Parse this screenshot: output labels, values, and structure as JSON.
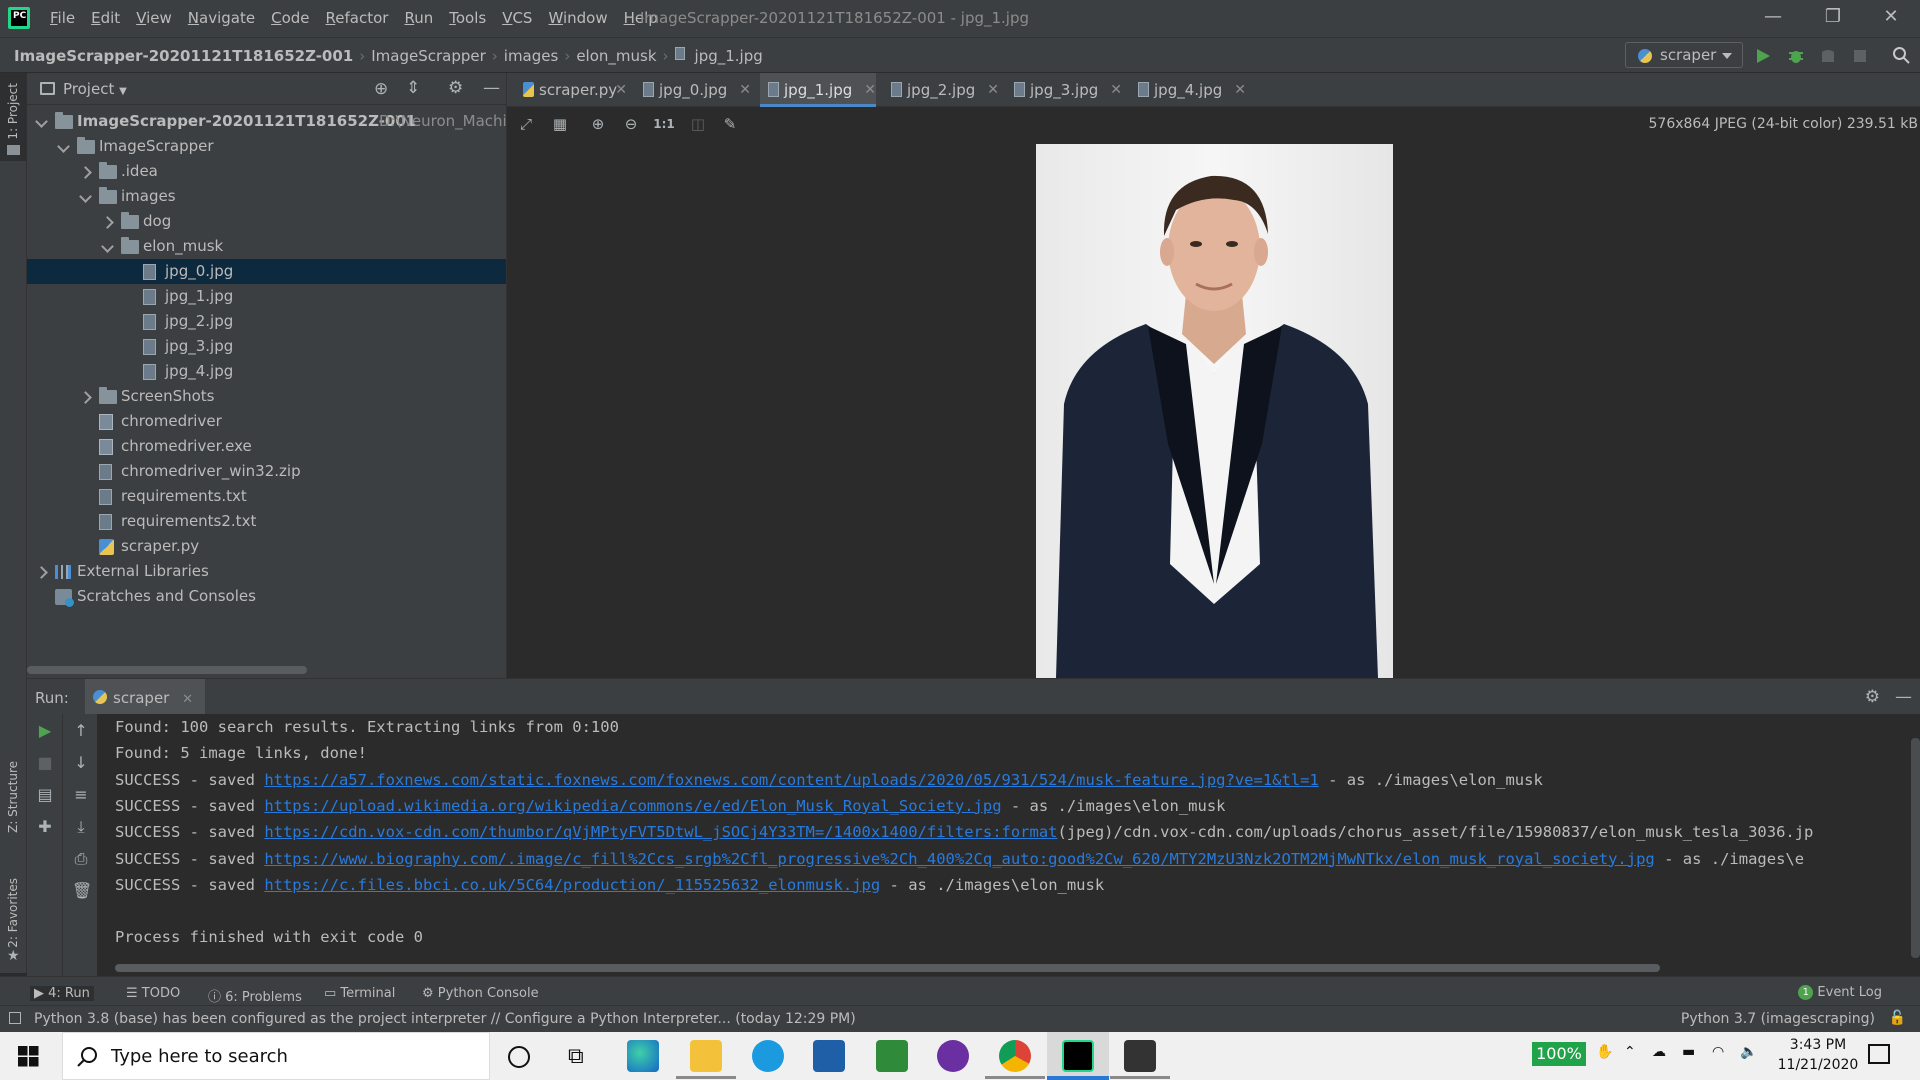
{
  "window": {
    "title": "ImageScrapper-20201121T181652Z-001 - jpg_1.jpg",
    "menu": [
      "File",
      "Edit",
      "View",
      "Navigate",
      "Code",
      "Refactor",
      "Run",
      "Tools",
      "VCS",
      "Window",
      "Help"
    ],
    "controls": {
      "minimize": "—",
      "restore": "❐",
      "close": "✕"
    }
  },
  "breadcrumb": [
    "ImageScrapper-20201121T181652Z-001",
    "ImageScrapper",
    "images",
    "elon_musk",
    "jpg_1.jpg"
  ],
  "run_config": {
    "label": "scraper"
  },
  "project_panel": {
    "title": "Project",
    "tree": [
      {
        "label": "ImageScrapper-20201121T181652Z-001",
        "extra": "D:\\Neuron_Machine",
        "level": 0,
        "type": "folder",
        "caret": "down",
        "bold": true
      },
      {
        "label": "ImageScrapper",
        "level": 1,
        "type": "folder",
        "caret": "down"
      },
      {
        "label": ".idea",
        "level": 2,
        "type": "folder",
        "caret": "right"
      },
      {
        "label": "images",
        "level": 2,
        "type": "folder",
        "caret": "down"
      },
      {
        "label": "dog",
        "level": 3,
        "type": "folder",
        "caret": "right"
      },
      {
        "label": "elon_musk",
        "level": 3,
        "type": "folder",
        "caret": "down"
      },
      {
        "label": "jpg_0.jpg",
        "level": 4,
        "type": "file",
        "selected": true
      },
      {
        "label": "jpg_1.jpg",
        "level": 4,
        "type": "file"
      },
      {
        "label": "jpg_2.jpg",
        "level": 4,
        "type": "file"
      },
      {
        "label": "jpg_3.jpg",
        "level": 4,
        "type": "file"
      },
      {
        "label": "jpg_4.jpg",
        "level": 4,
        "type": "file"
      },
      {
        "label": "ScreenShots",
        "level": 2,
        "type": "folder",
        "caret": "right"
      },
      {
        "label": "chromedriver",
        "level": 2,
        "type": "exe"
      },
      {
        "label": "chromedriver.exe",
        "level": 2,
        "type": "exe"
      },
      {
        "label": "chromedriver_win32.zip",
        "level": 2,
        "type": "file"
      },
      {
        "label": "requirements.txt",
        "level": 2,
        "type": "file"
      },
      {
        "label": "requirements2.txt",
        "level": 2,
        "type": "file"
      },
      {
        "label": "scraper.py",
        "level": 2,
        "type": "py"
      },
      {
        "label": "External Libraries",
        "level": 0,
        "type": "lib",
        "caret": "right"
      },
      {
        "label": "Scratches and Consoles",
        "level": 0,
        "type": "scratch"
      }
    ]
  },
  "left_strip": {
    "project": "1: Project",
    "structure": "Z: Structure",
    "favorites": "2: Favorites"
  },
  "editor_tabs": [
    {
      "label": "scraper.py",
      "icon": "python-file-icon"
    },
    {
      "label": "jpg_0.jpg",
      "icon": "image-file-icon"
    },
    {
      "label": "jpg_1.jpg",
      "icon": "image-file-icon",
      "active": true
    },
    {
      "label": "jpg_2.jpg",
      "icon": "image-file-icon"
    },
    {
      "label": "jpg_3.jpg",
      "icon": "image-file-icon"
    },
    {
      "label": "jpg_4.jpg",
      "icon": "image-file-icon"
    }
  ],
  "image_viewer": {
    "info": "576x864 JPEG (24-bit color) 239.51 kB",
    "zoom_actual_label": "1:1"
  },
  "run_panel": {
    "label": "Run:",
    "tab": "scraper",
    "console": [
      {
        "text": "Found: 100 search results. Extracting links from 0:100"
      },
      {
        "text": "Found: 5 image links, done!"
      },
      {
        "prefix": "SUCCESS - saved ",
        "link": "https://a57.foxnews.com/static.foxnews.com/foxnews.com/content/uploads/2020/05/931/524/musk-feature.jpg?ve=1&tl=1",
        "suffix": " - as ./images\\elon_musk"
      },
      {
        "prefix": "SUCCESS - saved ",
        "link": "https://upload.wikimedia.org/wikipedia/commons/e/ed/Elon_Musk_Royal_Society.jpg",
        "suffix": " - as ./images\\elon_musk"
      },
      {
        "prefix": "SUCCESS - saved ",
        "link": "https://cdn.vox-cdn.com/thumbor/qVjMPtyFVT5DtwL_jSOCj4Y33TM=/1400x1400/filters:format",
        "suffix": "(jpeg)/cdn.vox-cdn.com/uploads/chorus_asset/file/15980837/elon_musk_tesla_3036.jp"
      },
      {
        "prefix": "SUCCESS - saved ",
        "link": "https://www.biography.com/.image/c_fill%2Ccs_srgb%2Cfl_progressive%2Ch_400%2Cq_auto:good%2Cw_620/MTY2MzU3Nzk2OTM2MjMwNTkx/elon_musk_royal_society.jpg",
        "suffix": " - as ./images\\e"
      },
      {
        "prefix": "SUCCESS - saved ",
        "link": "https://c.files.bbci.co.uk/5C64/production/_115525632_elonmusk.jpg",
        "suffix": " - as ./images\\elon_musk"
      },
      {
        "text": ""
      },
      {
        "text": "Process finished with exit code 0"
      }
    ]
  },
  "bottom_tabs": [
    {
      "label": "4: Run",
      "icon": "run-icon",
      "active": true
    },
    {
      "label": "TODO",
      "icon": "todo-icon"
    },
    {
      "label": "6: Problems",
      "icon": "problems-icon"
    },
    {
      "label": "Terminal",
      "icon": "terminal-icon"
    },
    {
      "label": "Python Console",
      "icon": "python-console-icon"
    }
  ],
  "event_log": {
    "label": "Event Log",
    "count": "1"
  },
  "status": {
    "message": "Python 3.8 (base) has been configured as the project interpreter // Configure a Python Interpreter... (today 12:29 PM)",
    "interpreter": "Python 3.7 (imagescraping)"
  },
  "taskbar": {
    "search_placeholder": "Type here to search",
    "battery": "100%",
    "time": "3:43 PM",
    "date": "11/21/2020"
  },
  "colors": {
    "accent": "#4a88c7",
    "link": "#287bde",
    "selection": "#0d293e",
    "bg": "#2b2b2b",
    "panel": "#3c3f41"
  }
}
